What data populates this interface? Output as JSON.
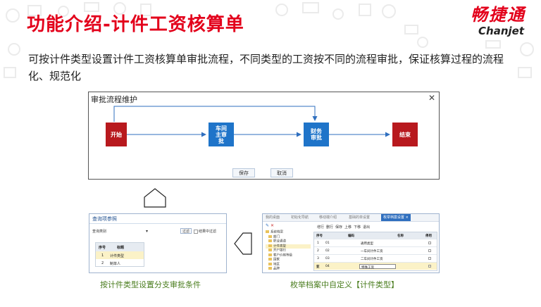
{
  "slide": {
    "title": "功能介绍-计件工资核算单",
    "description": "可按计件类型设置计件工资核算单审批流程，不同类型的工资按不同的流程审批，保证核算过程的流程化、规范化"
  },
  "logo": {
    "cn": "畅捷通",
    "en": "Chanjet"
  },
  "colors": {
    "brand_red": "#e3001b",
    "node_red": "#b8191e",
    "node_blue": "#1f74c9",
    "caption_green": "#4a7d1e"
  },
  "approval_dialog": {
    "title": "审批流程维护",
    "close_icon": "✕",
    "nodes": [
      {
        "label": "开始",
        "type": "start"
      },
      {
        "label": "车间\n主审\n批",
        "type": "step"
      },
      {
        "label": "财务\n审批",
        "type": "step"
      },
      {
        "label": "结束",
        "type": "end"
      }
    ],
    "save_label": "保存",
    "cancel_label": "取消"
  },
  "reference_panel": {
    "title": "查询项参照",
    "filter_label": "查询类别",
    "dropdown_icon": "▾",
    "filter_button": "过滤",
    "checkbox_label": "结果中过滤",
    "columns": [
      "序号",
      "标题"
    ],
    "rows": [
      {
        "no": "1",
        "title": "计件类型",
        "selected": true
      },
      {
        "no": "2",
        "title": "制单人",
        "selected": false
      }
    ],
    "caption": "按计件类型设置分支审批条件"
  },
  "enum_panel": {
    "tabs": [
      "我的桌面",
      "初始化导航",
      "移动端介绍",
      "基础的单设置",
      "枚举档案设置"
    ],
    "active_tab_close": "×",
    "toolbar": [
      "增行",
      "删行",
      "保存",
      "上移",
      "下移",
      "退出"
    ],
    "tree": [
      "系统档案",
      "部门",
      "职业通道",
      "计件类型",
      "开户银行",
      "客户价格等级",
      "国家",
      "地区",
      "品牌"
    ],
    "columns": [
      "序号",
      "编码",
      "名称",
      "停用"
    ],
    "rows": [
      {
        "no": "1",
        "code": "01",
        "name": "通用类型"
      },
      {
        "no": "2",
        "code": "02",
        "name": "一车间计件工资"
      },
      {
        "no": "3",
        "code": "03",
        "name": "二车间计件工资"
      },
      {
        "no": "4",
        "code": "04",
        "name": "特殊工资"
      }
    ],
    "current_row_marker": "亚",
    "caption": "枚举档案中自定义【计件类型】"
  }
}
